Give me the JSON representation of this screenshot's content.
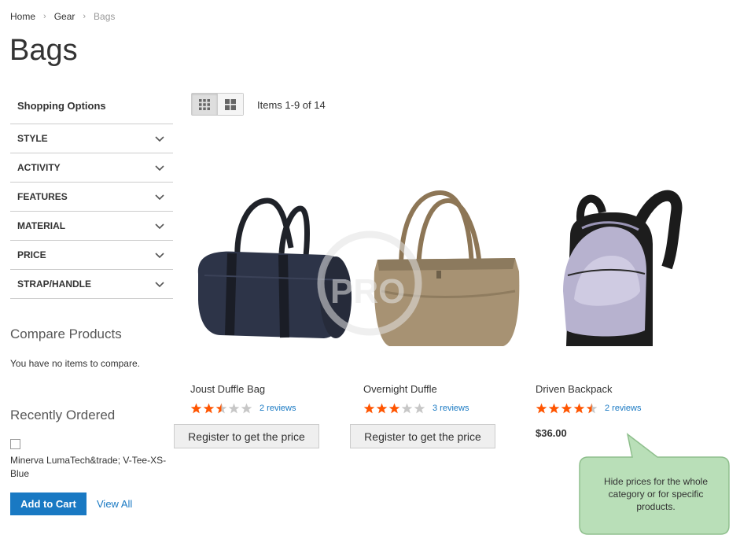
{
  "breadcrumb": {
    "home": "Home",
    "gear": "Gear",
    "current": "Bags"
  },
  "page_title": "Bags",
  "sidebar": {
    "shopping_options": "Shopping Options",
    "filters": [
      "STYLE",
      "ACTIVITY",
      "FEATURES",
      "MATERIAL",
      "PRICE",
      "STRAP/HANDLE"
    ],
    "compare": {
      "title": "Compare Products",
      "empty": "You have no items to compare."
    },
    "recent": {
      "title": "Recently Ordered",
      "item": "Minerva LumaTech&trade; V-Tee-XS-Blue",
      "add_to_cart": "Add to Cart",
      "view_all": "View All"
    }
  },
  "toolbar": {
    "amount": "Items 1-9 of 14",
    "mode_active": "grid"
  },
  "products": [
    {
      "name": "Joust Duffle Bag",
      "rating": 2.5,
      "reviews": "2 reviews",
      "price_button": "Register to get the price"
    },
    {
      "name": "Overnight Duffle",
      "rating": 3,
      "reviews": "3 reviews",
      "price_button": "Register to get the price"
    },
    {
      "name": "Driven Backpack",
      "rating": 4.5,
      "reviews": "2 reviews",
      "price": "$36.00"
    }
  ],
  "callout": {
    "text": "Hide prices for the whole category or for specific products."
  },
  "colors": {
    "accent": "#1979c3",
    "star": "#ff5501",
    "star_empty": "#c7c7c7",
    "callout_bg": "#b9dfb8",
    "callout_border": "#8fbf8d"
  }
}
